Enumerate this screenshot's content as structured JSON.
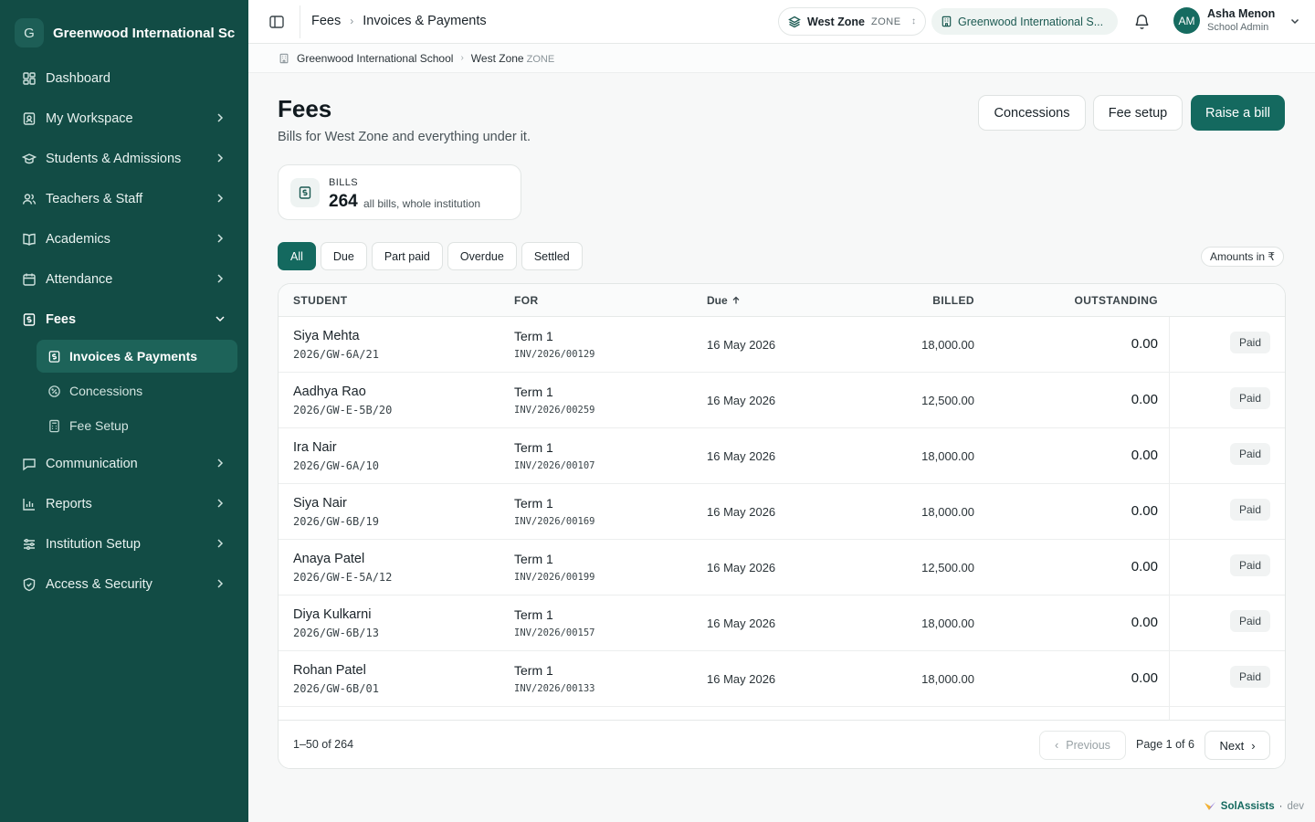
{
  "brand": {
    "initial": "G",
    "name": "Greenwood International Sc..."
  },
  "nav": {
    "items": [
      {
        "label": "Dashboard",
        "icon": "dashboard-icon"
      },
      {
        "label": "My Workspace",
        "icon": "workspace-icon"
      },
      {
        "label": "Students & Admissions",
        "icon": "graduation-cap-icon"
      },
      {
        "label": "Teachers & Staff",
        "icon": "users-icon"
      },
      {
        "label": "Academics",
        "icon": "book-icon"
      },
      {
        "label": "Attendance",
        "icon": "calendar-icon"
      },
      {
        "label": "Fees",
        "icon": "receipt-icon"
      },
      {
        "label": "Communication",
        "icon": "message-icon"
      },
      {
        "label": "Reports",
        "icon": "bar-chart-icon"
      },
      {
        "label": "Institution Setup",
        "icon": "sliders-icon"
      },
      {
        "label": "Access & Security",
        "icon": "shield-icon"
      }
    ],
    "fees_sub": [
      {
        "label": "Invoices & Payments",
        "icon": "receipt-icon"
      },
      {
        "label": "Concessions",
        "icon": "discount-icon"
      },
      {
        "label": "Fee Setup",
        "icon": "calculator-icon"
      }
    ]
  },
  "topbar": {
    "crumb_root": "Fees",
    "crumb_current": "Invoices & Payments",
    "zone_name": "West Zone",
    "zone_tag": "ZONE",
    "school": "Greenwood International S...",
    "user_initials": "AM",
    "user_name": "Asha Menon",
    "user_role": "School Admin"
  },
  "subcrumb": {
    "school": "Greenwood International School",
    "zone": "West Zone",
    "zone_tag": "ZONE"
  },
  "page": {
    "title": "Fees",
    "subtitle": "Bills for West Zone and everything under it.",
    "btn_concessions": "Concessions",
    "btn_fee_setup": "Fee setup",
    "btn_raise": "Raise a bill"
  },
  "stat": {
    "label": "BILLS",
    "value": "264",
    "note": "all bills, whole institution"
  },
  "filters": [
    "All",
    "Due",
    "Part paid",
    "Overdue",
    "Settled"
  ],
  "amounts_label": "Amounts in ₹",
  "table": {
    "headers": {
      "student": "STUDENT",
      "for": "FOR",
      "due": "Due",
      "billed": "BILLED",
      "outstanding": "OUTSTANDING"
    },
    "rows": [
      {
        "name": "Siya Mehta",
        "id": "2026/GW-6A/21",
        "term": "Term 1",
        "invoice": "INV/2026/00129",
        "due": "16 May 2026",
        "billed": "18,000.00",
        "outstanding": "0.00",
        "status": "Paid"
      },
      {
        "name": "Aadhya Rao",
        "id": "2026/GW-E-5B/20",
        "term": "Term 1",
        "invoice": "INV/2026/00259",
        "due": "16 May 2026",
        "billed": "12,500.00",
        "outstanding": "0.00",
        "status": "Paid"
      },
      {
        "name": "Ira Nair",
        "id": "2026/GW-6A/10",
        "term": "Term 1",
        "invoice": "INV/2026/00107",
        "due": "16 May 2026",
        "billed": "18,000.00",
        "outstanding": "0.00",
        "status": "Paid"
      },
      {
        "name": "Siya Nair",
        "id": "2026/GW-6B/19",
        "term": "Term 1",
        "invoice": "INV/2026/00169",
        "due": "16 May 2026",
        "billed": "18,000.00",
        "outstanding": "0.00",
        "status": "Paid"
      },
      {
        "name": "Anaya Patel",
        "id": "2026/GW-E-5A/12",
        "term": "Term 1",
        "invoice": "INV/2026/00199",
        "due": "16 May 2026",
        "billed": "12,500.00",
        "outstanding": "0.00",
        "status": "Paid"
      },
      {
        "name": "Diya Kulkarni",
        "id": "2026/GW-6B/13",
        "term": "Term 1",
        "invoice": "INV/2026/00157",
        "due": "16 May 2026",
        "billed": "18,000.00",
        "outstanding": "0.00",
        "status": "Paid"
      },
      {
        "name": "Rohan Patel",
        "id": "2026/GW-6B/01",
        "term": "Term 1",
        "invoice": "INV/2026/00133",
        "due": "16 May 2026",
        "billed": "18,000.00",
        "outstanding": "0.00",
        "status": "Paid"
      }
    ],
    "range": "1–50 of 264",
    "prev": "Previous",
    "page_info": "Page 1 of 6",
    "next": "Next"
  },
  "footer": {
    "brand": "SolAssists",
    "sep": "·",
    "env": "dev"
  },
  "colors": {
    "sidebar": "#124c45",
    "accent": "#14695f"
  }
}
